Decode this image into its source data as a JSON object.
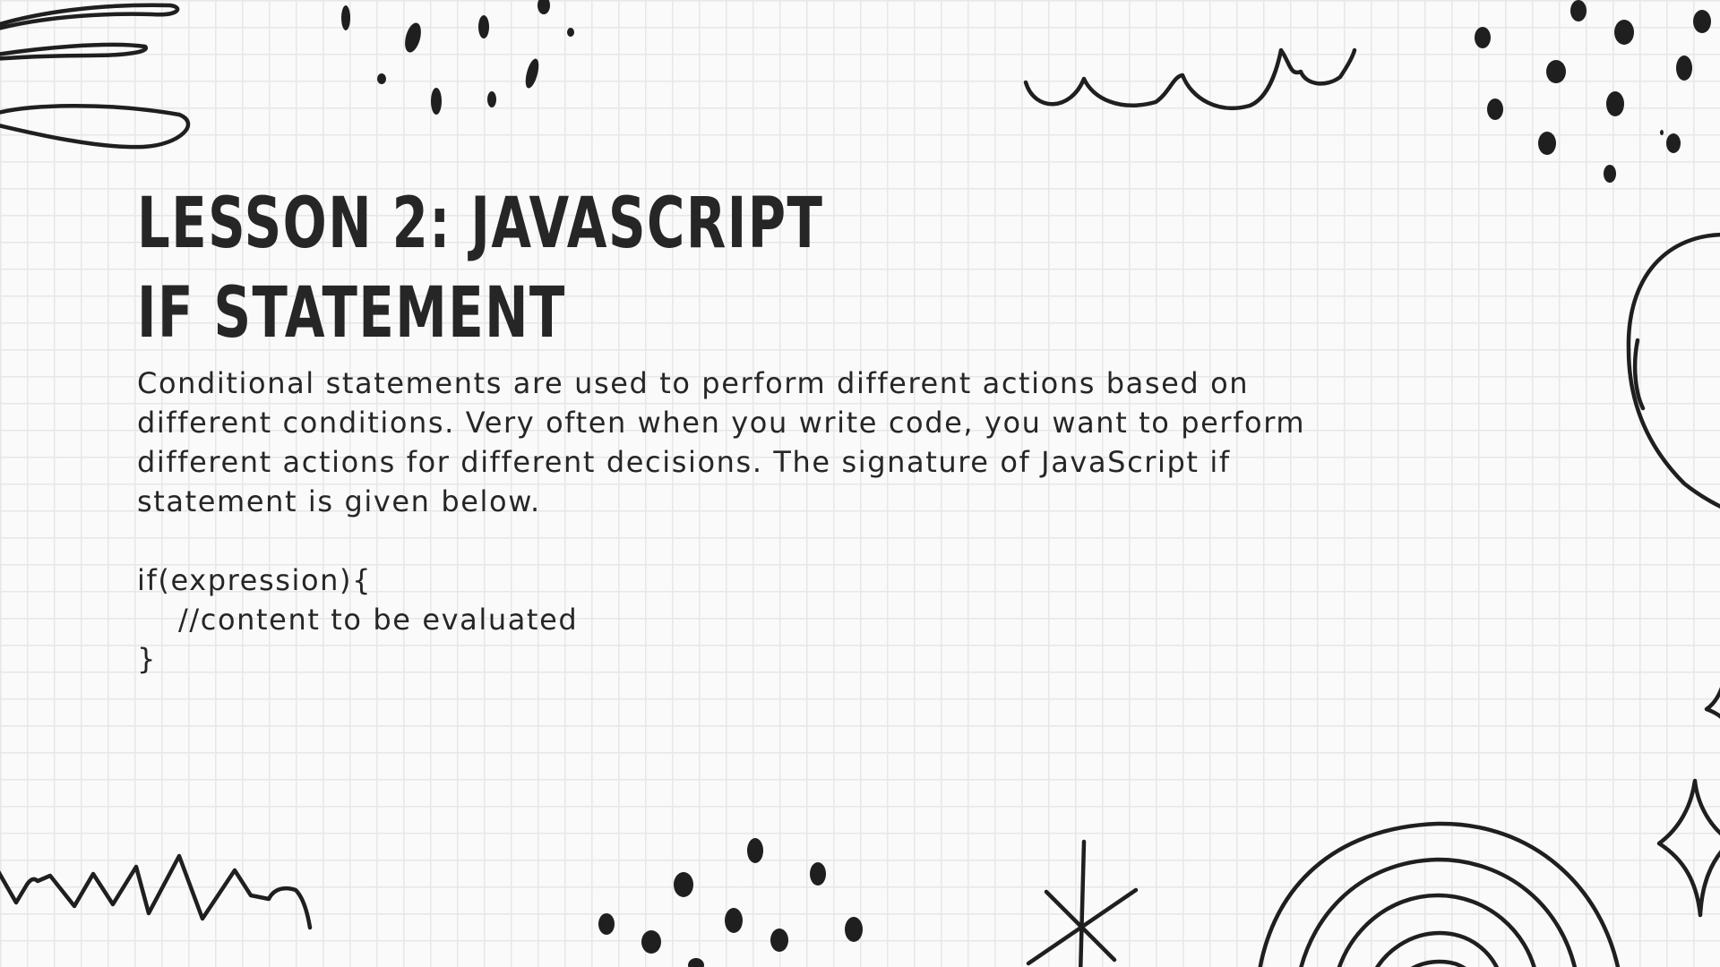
{
  "slide": {
    "title_lines": [
      "Lesson 2: JavaScript",
      "if statement"
    ],
    "description": "Conditional statements are used to perform different actions based on different conditions. Very often when you write code, you want to perform different actions for different decisions. The signature of JavaScript if statement is given below.",
    "code_lines": [
      "if(expression){",
      "//content to be evaluated",
      "}"
    ]
  },
  "colors": {
    "background": "#fafafa",
    "grid": "#e7e7e7",
    "ink": "#262626"
  }
}
